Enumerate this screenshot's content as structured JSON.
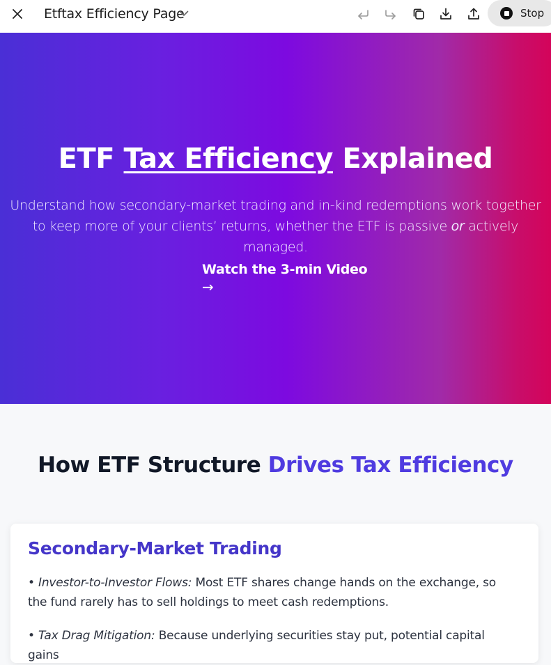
{
  "toolbar": {
    "title": "Etftax Efficiency Page",
    "stop_label": "Stop",
    "icons": [
      "close-icon",
      "chevron-down-icon",
      "undo-icon",
      "redo-icon",
      "copy-icon",
      "download-icon",
      "share-icon",
      "stop-icon"
    ]
  },
  "hero": {
    "title_pre": "ETF ",
    "title_underlined": "Tax Efficiency",
    "title_post": " Explained",
    "subtitle_pre": "Understand how secondary-market trading and in-kind redemptions work together to keep more of your clients’ returns, whether the ETF is passive ",
    "subtitle_em": "or",
    "subtitle_post": " actively managed.",
    "cta_label": "Watch the 3-min Video",
    "cta_arrow": "→"
  },
  "section": {
    "title_pre": "How ETF Structure ",
    "title_accent": "Drives Tax Efficiency"
  },
  "card": {
    "title": "Secondary-Market Trading",
    "items": [
      {
        "bullet": "• ",
        "label": "Investor-to-Investor Flows:",
        "text": " Most ETF shares change hands on the exchange, so the fund rarely has to sell holdings to meet cash redemptions."
      },
      {
        "bullet": "• ",
        "label": "Tax Drag Mitigation:",
        "text": " Because underlying securities stay put, potential capital gains"
      }
    ]
  },
  "colors": {
    "accent": "#4f3be0",
    "hero_gradient_start": "#4a2fd6",
    "hero_gradient_mid": "#7d0ae0",
    "hero_gradient_end": "#d4045a"
  }
}
